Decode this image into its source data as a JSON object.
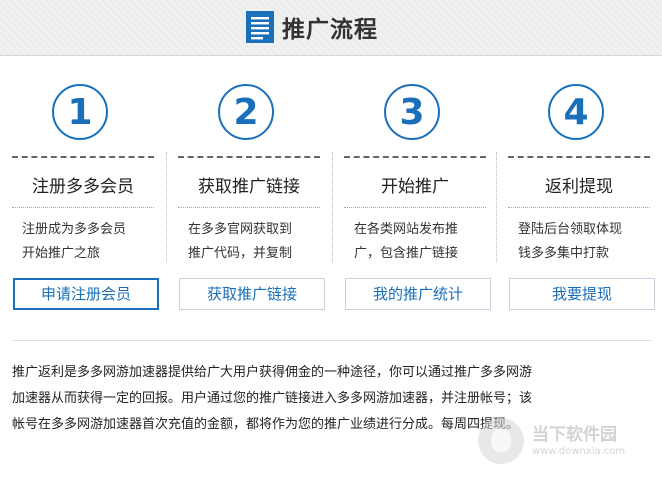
{
  "header": {
    "title": "推广流程",
    "icon": "document-icon",
    "accent_color": "#1a6fba"
  },
  "steps": [
    {
      "number": "1",
      "title": "注册多多会员",
      "desc_lines": [
        "注册成为多多会员",
        "开始推广之旅"
      ],
      "button": "申请注册会员"
    },
    {
      "number": "2",
      "title": "获取推广链接",
      "desc_lines": [
        "在多多官网获取到",
        "推广代码，并复制"
      ],
      "button": "获取推广链接"
    },
    {
      "number": "3",
      "title": "开始推广",
      "desc_lines": [
        "在各类网站发布推",
        "广，包含推广链接"
      ],
      "button": "我的推广统计"
    },
    {
      "number": "4",
      "title": "返利提现",
      "desc_lines": [
        "登陆后台领取体现",
        "钱多多集中打款"
      ],
      "button": "我要提现"
    }
  ],
  "description": {
    "lines": [
      "推广返利是多多网游加速器提供给广大用户获得佣金的一种途径，你可以通过推广多多网游",
      "加速器从而获得一定的回报。用户通过您的推广链接进入多多网游加速器，并注册帐号；该",
      "帐号在多多网游加速器首次充值的金额，都将作为您的推广业绩进行分成。每周四提现。"
    ]
  },
  "watermark": {
    "text": "当下软件园",
    "url": "www.downxia.com"
  }
}
